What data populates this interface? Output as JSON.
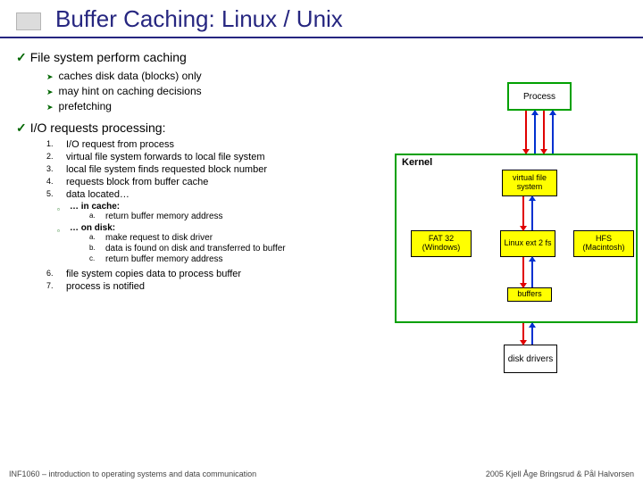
{
  "title": "Buffer Caching: Linux / Unix",
  "section1": {
    "heading": "File system perform caching",
    "items": [
      "caches disk data (blocks) only",
      "may hint on caching decisions",
      "prefetching"
    ]
  },
  "section2": {
    "heading": "I/O requests processing:",
    "steps": [
      "I/O request from process",
      "virtual file system forwards to local file system",
      "local file system finds requested block number",
      "requests block from buffer cache",
      "data located…"
    ],
    "incache_label": "… in cache:",
    "incache_items": [
      "return buffer memory address"
    ],
    "ondisk_label": "… on disk:",
    "ondisk_items": [
      "make request to disk driver",
      "data is found on disk and transferred to buffer",
      "return buffer memory address"
    ],
    "steps_tail": [
      "file system copies data to process buffer",
      "process is notified"
    ]
  },
  "diagram": {
    "process": "Process",
    "kernel": "Kernel",
    "vfs": "virtual file system",
    "fat": "FAT 32 (Windows)",
    "ext": "Linux ext 2 fs",
    "hfs": "HFS (Macintosh)",
    "buffers": "buffers",
    "disk": "disk drivers"
  },
  "footer": {
    "left": "INF1060 – introduction to operating systems and data communication",
    "right": "2005 Kjell Åge Bringsrud & Pål Halvorsen"
  }
}
